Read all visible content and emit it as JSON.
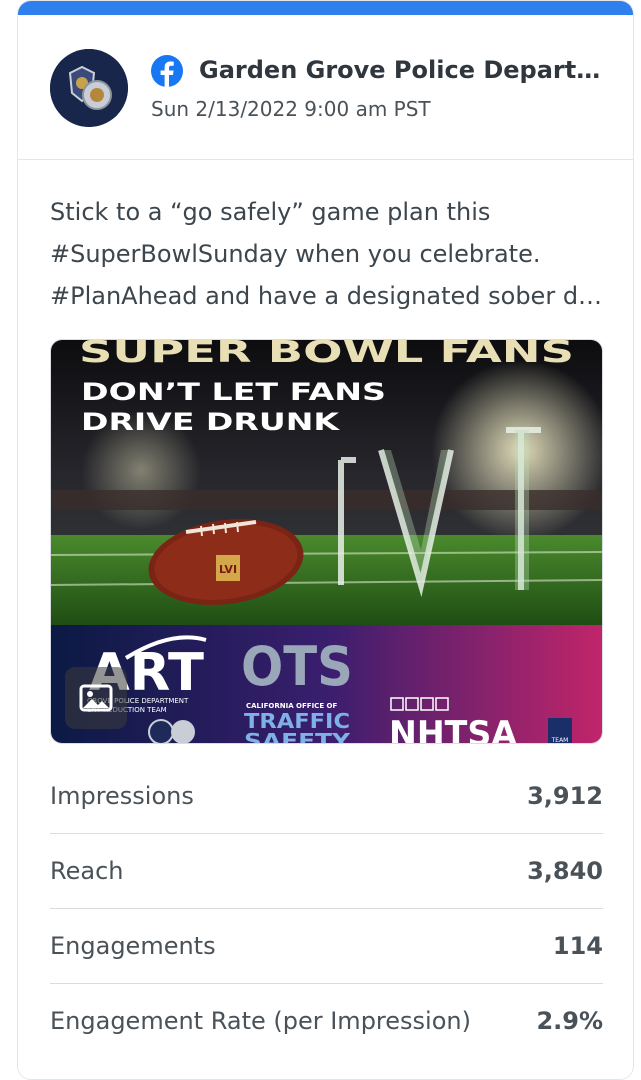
{
  "brand": {
    "accent": "#2f80ed",
    "facebook_blue": "#1877f2"
  },
  "post": {
    "page_name": "Garden Grove Police Department",
    "network_icon": "facebook-icon",
    "timestamp": "Sun 2/13/2022 9:00 am PST",
    "text_lines": [
      "Stick to a “go safely” game plan this",
      "#SuperBowlSunday when you celebrate.",
      "#PlanAhead and have a designated sober driver"
    ],
    "media": {
      "headline": "SUPER BOWL FANS",
      "subhead_line1": "DON’T LET FANS",
      "subhead_line2": "DRIVE DRUNK",
      "roman_numeral": "LVI",
      "football_text": "LVI",
      "logo_art": "ART",
      "logo_art_sub1": "GROVE POLICE DEPARTMENT",
      "logo_art_sub2": "ENT REDUCTION TEAM",
      "logo_ots": "OTS",
      "logo_ots_sub": "CALIFORNIA OFFICE OF",
      "logo_ots_main1": "TRAFFIC",
      "logo_ots_main2": "SAFETY",
      "logo_nhtsa": "NHTSA",
      "logo_team": "TEAM",
      "media_type_icon": "image-icon"
    }
  },
  "stats": [
    {
      "label": "Impressions",
      "value": "3,912"
    },
    {
      "label": "Reach",
      "value": "3,840"
    },
    {
      "label": "Engagements",
      "value": "114"
    },
    {
      "label": "Engagement Rate (per Impression)",
      "value": "2.9%"
    }
  ]
}
